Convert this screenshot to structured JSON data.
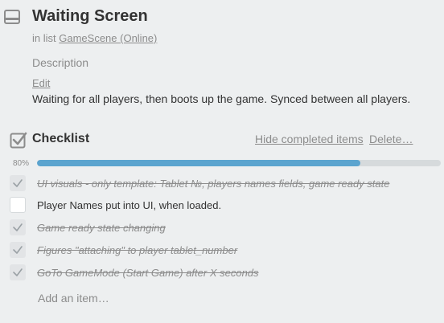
{
  "card": {
    "title": "Waiting Screen",
    "in_list_prefix": "in list",
    "list_name": "GameScene (Online)",
    "description_label": "Description",
    "edit_label": "Edit",
    "description": "Waiting for all players, then boots up the game. Synced between all players."
  },
  "checklist": {
    "title": "Checklist",
    "hide_completed_label": "Hide completed items",
    "delete_label": "Delete…",
    "progress_label": "80%",
    "progress_fraction": 0.8,
    "items": [
      {
        "text": "UI visuals - only template: Tablet №, players names fields, game ready state",
        "done": true
      },
      {
        "text": "Player Names put into UI, when loaded.",
        "done": false
      },
      {
        "text": "Game ready state changing",
        "done": true
      },
      {
        "text": "Figures \"attaching\" to player tablet_number",
        "done": true
      },
      {
        "text": "GoTo GameMode (Start Game) after X seconds",
        "done": true
      }
    ],
    "add_item_label": "Add an item…"
  },
  "icons": {
    "card": "card-icon",
    "checklist": "checklist-icon",
    "check": "check-icon"
  },
  "colors": {
    "background": "#edeff0",
    "progress_fill": "#5ba4cf",
    "progress_track": "#d6dadc",
    "muted_text": "#8c8c8c"
  }
}
